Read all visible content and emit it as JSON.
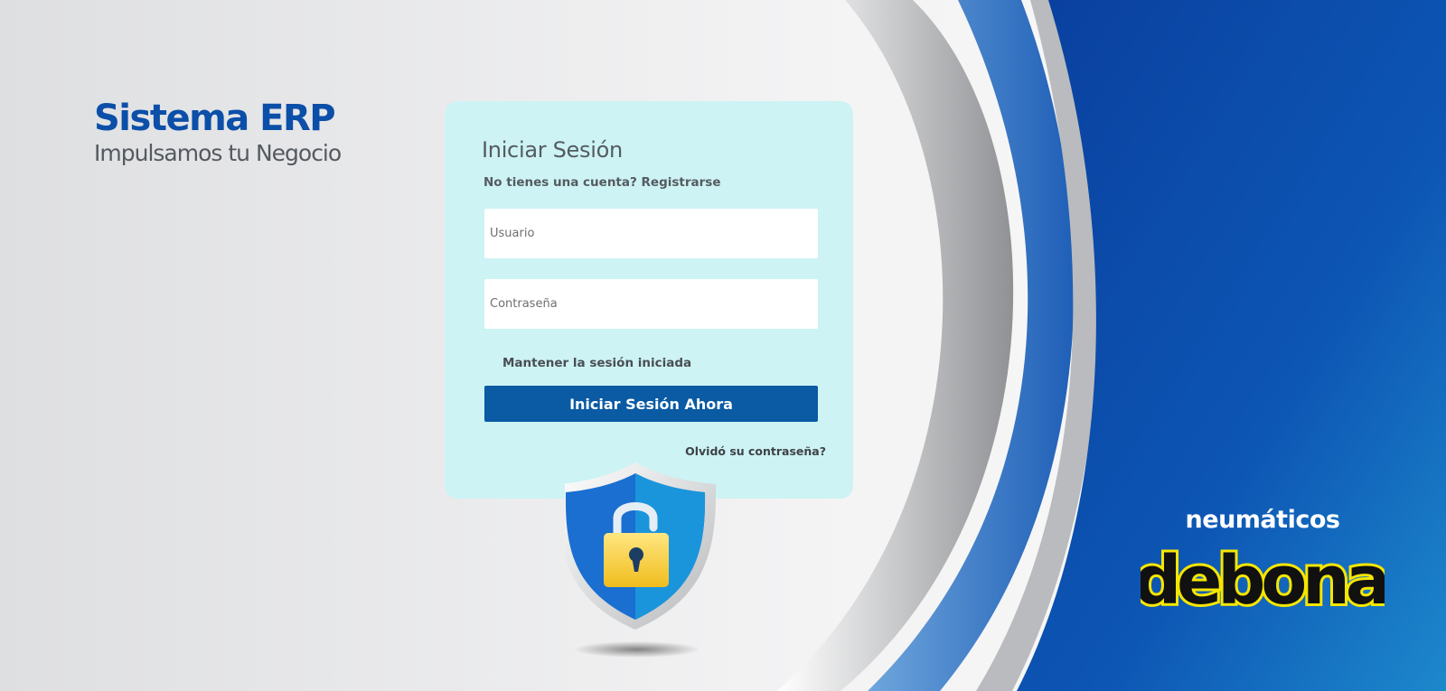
{
  "brand": {
    "title": "Sistema ERP",
    "subtitle": "Impulsamos tu Negocio"
  },
  "login": {
    "title": "Iniciar Sesión",
    "no_account": "No tienes una cuenta?",
    "register": "Registrarse",
    "username_placeholder": "Usuario",
    "password_placeholder": "Contraseña",
    "remember_label": "Mantener la sesión iniciada",
    "submit_label": "Iniciar Sesión Ahora",
    "forgot": "Olvidó su contraseña?"
  },
  "company_logo": {
    "top_text": "neumáticos",
    "wordmark": "debona"
  },
  "icons": {
    "security": "shield-lock-icon"
  },
  "colors": {
    "brand_blue": "#0b4fa8",
    "button_blue": "#0a5aa4",
    "card_bg": "#cdf3f4",
    "logo_yellow": "#f5e600"
  }
}
